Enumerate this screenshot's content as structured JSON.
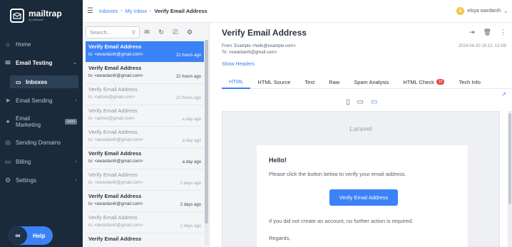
{
  "sidebar": {
    "logo": {
      "name": "mailtrap",
      "sub": "by railsware"
    },
    "nav": [
      {
        "label": "Home",
        "icon": "home-icon"
      },
      {
        "label": "Email Testing",
        "icon": "test-mail-icon"
      },
      {
        "label": "Email Sending",
        "icon": "send-icon"
      },
      {
        "label": "Email Marketing",
        "icon": "marketing-icon",
        "badge": "soon"
      },
      {
        "label": "Sending Domains",
        "icon": "globe-icon"
      },
      {
        "label": "Billing",
        "icon": "card-icon"
      },
      {
        "label": "Settings",
        "icon": "gear-icon"
      }
    ],
    "inboxes_label": "Inboxes",
    "help_label": "Help"
  },
  "topbar": {
    "crumbs": [
      "Inboxes",
      "My Inbox",
      "Verify Email Address"
    ],
    "user": {
      "initial": "E",
      "name": "elsya wardanih"
    }
  },
  "list": {
    "search_placeholder": "Search...",
    "messages": [
      {
        "subject": "Verify Email Address",
        "to": "to: <ewardanih@gmail.com>",
        "time": "21 hours ago",
        "state": "sel"
      },
      {
        "subject": "Verify Email Address",
        "to": "to: <ewardanih@gmail.com>",
        "time": "21 hours ago",
        "state": "unread"
      },
      {
        "subject": "Verify Email Address",
        "to": "to: <admin@gmail.com>",
        "time": "21 hours ago",
        "state": "read"
      },
      {
        "subject": "Verify Email Address",
        "to": "to: <admin@gmail.com>",
        "time": "a day ago",
        "state": "read"
      },
      {
        "subject": "Verify Email Address",
        "to": "to: <ewardanih@gmail.com>",
        "time": "a day ago",
        "state": "read"
      },
      {
        "subject": "Verify Email Address",
        "to": "to: <ewardanih@gmail.com>",
        "time": "a day ago",
        "state": "unread"
      },
      {
        "subject": "Verify Email Address",
        "to": "to: <ewardanih@gmail.com>",
        "time": "2 days ago",
        "state": "read"
      },
      {
        "subject": "Verify Email Address",
        "to": "to: <ewardanih@gmail.com>",
        "time": "2 days ago",
        "state": "unread"
      },
      {
        "subject": "Verify Email Address",
        "to": "to: <ewardanih@gmail.com>",
        "time": "2 days ago",
        "state": "read"
      },
      {
        "subject": "Verify Email Address",
        "to": "",
        "time": "",
        "state": "unread"
      }
    ]
  },
  "detail": {
    "title": "Verify Email Address",
    "from": "From: Example <hello@example.com>",
    "to": "To:   <ewardanih@gmail.com>",
    "date": "2024-04-20 16:12, 13 KB",
    "show_headers": "Show Headers",
    "tabs": [
      "HTML",
      "HTML Source",
      "Text",
      "Raw",
      "Spam Analysis",
      "HTML Check",
      "Tech Info"
    ],
    "html_check_badge": "15",
    "preview": {
      "brand": "Laravel",
      "hello": "Hello!",
      "line1": "Please click the button below to verify your email address.",
      "button": "Verify Email Address",
      "line2": "If you did not create an account, no further action is required.",
      "regards": "Regards,"
    }
  }
}
